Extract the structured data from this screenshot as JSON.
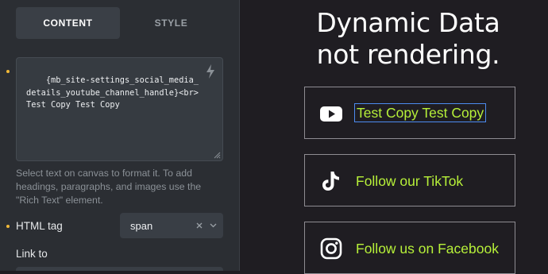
{
  "panel": {
    "tabs": [
      {
        "label": "CONTENT",
        "active": true
      },
      {
        "label": "STYLE",
        "active": false
      }
    ],
    "text_value": "{mb_site-settings_social_media_details_youtube_channel_handle}<br>Test Copy Test Copy",
    "help_text": "Select text on canvas to format it. To add headings, paragraphs, and images use the \"Rich Text\" element.",
    "html_tag": {
      "label": "HTML tag",
      "value": "span"
    },
    "link_to": {
      "label": "Link to"
    },
    "colors": {
      "accent_dot": "#f1b938",
      "panel_bg": "#2b2e33"
    }
  },
  "canvas": {
    "heading_lines": [
      "Dynamic Data",
      "not rendering."
    ],
    "buttons": [
      {
        "icon": "youtube-icon",
        "label": "Test Copy Test Copy",
        "selected": true
      },
      {
        "icon": "tiktok-icon",
        "label": "Follow our TikTok",
        "selected": false
      },
      {
        "icon": "instagram-icon",
        "label": "Follow us on Facebook",
        "selected": false
      }
    ],
    "colors": {
      "background": "#1f1d22",
      "label": "#b7f139",
      "border": "#8e8c92",
      "selection": "#4c8bf0"
    }
  }
}
